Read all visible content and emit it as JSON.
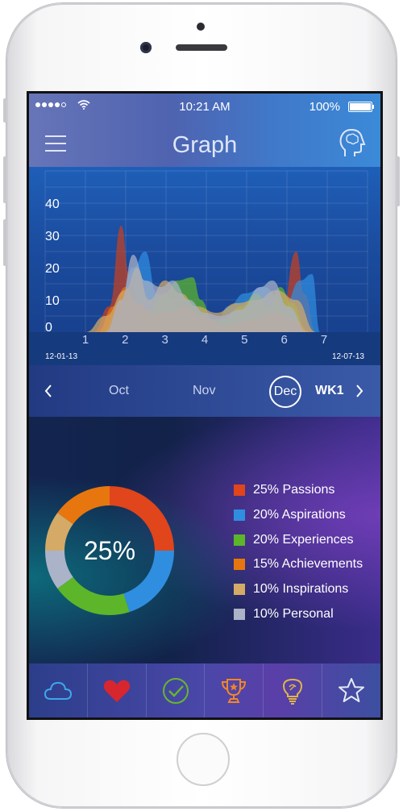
{
  "status": {
    "time": "10:21 AM",
    "battery": "100%"
  },
  "header": {
    "title": "Graph",
    "menu_icon": "hamburger-menu-icon",
    "profile_icon": "head-brain-icon"
  },
  "chart_data": {
    "type": "area",
    "x": [
      1,
      2,
      3,
      4,
      5,
      6,
      7
    ],
    "yticks": [
      0,
      10,
      20,
      30,
      40
    ],
    "ylim": [
      0,
      45
    ],
    "xlim": [
      1,
      7
    ],
    "grid": true,
    "start_date": "12-01-13",
    "end_date": "12-07-13",
    "series": [
      {
        "color": "#c8401e",
        "points": [
          [
            1.2,
            0
          ],
          [
            1.6,
            8
          ],
          [
            1.9,
            33
          ],
          [
            2.1,
            18
          ],
          [
            2.4,
            2
          ],
          [
            2.9,
            0
          ],
          [
            4.4,
            0
          ],
          [
            5.2,
            0
          ],
          [
            5.9,
            3
          ],
          [
            6.3,
            25
          ],
          [
            6.5,
            12
          ],
          [
            6.8,
            0
          ]
        ]
      },
      {
        "color": "#2f8ee0",
        "points": [
          [
            1.4,
            0
          ],
          [
            1.8,
            6
          ],
          [
            2.2,
            20
          ],
          [
            2.5,
            25
          ],
          [
            2.8,
            12
          ],
          [
            3.1,
            10
          ],
          [
            3.5,
            4
          ],
          [
            4.2,
            0
          ],
          [
            4.6,
            8
          ],
          [
            5.0,
            12
          ],
          [
            5.5,
            14
          ],
          [
            6.0,
            8
          ],
          [
            6.4,
            16
          ],
          [
            6.7,
            18
          ],
          [
            6.9,
            0
          ]
        ]
      },
      {
        "color": "#5db52a",
        "points": [
          [
            2.0,
            0
          ],
          [
            2.5,
            6
          ],
          [
            3.0,
            12
          ],
          [
            3.3,
            16
          ],
          [
            3.7,
            17
          ],
          [
            3.9,
            10
          ],
          [
            4.2,
            4
          ],
          [
            4.5,
            4
          ],
          [
            4.9,
            8
          ],
          [
            5.3,
            12
          ],
          [
            5.6,
            8
          ],
          [
            5.9,
            14
          ],
          [
            6.2,
            9
          ],
          [
            6.6,
            0
          ]
        ]
      },
      {
        "color": "#e8760f",
        "points": [
          [
            1.3,
            0
          ],
          [
            1.7,
            8
          ],
          [
            2.0,
            14
          ],
          [
            2.3,
            9
          ],
          [
            2.7,
            6
          ],
          [
            3.1,
            6
          ],
          [
            3.5,
            8
          ],
          [
            3.9,
            5
          ],
          [
            4.5,
            2
          ],
          [
            5.2,
            4
          ],
          [
            5.8,
            6
          ],
          [
            6.2,
            4
          ],
          [
            6.7,
            0
          ]
        ]
      },
      {
        "color": "#d4aa66",
        "points": [
          [
            1.0,
            0
          ],
          [
            1.5,
            5
          ],
          [
            2.0,
            13
          ],
          [
            2.3,
            20
          ],
          [
            2.6,
            10
          ],
          [
            3.0,
            16
          ],
          [
            3.4,
            12
          ],
          [
            3.8,
            8
          ],
          [
            4.3,
            6
          ],
          [
            4.8,
            9
          ],
          [
            5.3,
            10
          ],
          [
            5.8,
            13
          ],
          [
            6.3,
            10
          ],
          [
            6.8,
            0
          ]
        ]
      },
      {
        "color": "#aab3c7",
        "points": [
          [
            1.5,
            0
          ],
          [
            1.9,
            10
          ],
          [
            2.2,
            24
          ],
          [
            2.5,
            16
          ],
          [
            2.9,
            14
          ],
          [
            3.2,
            16
          ],
          [
            3.6,
            10
          ],
          [
            4.0,
            6
          ],
          [
            4.4,
            5
          ],
          [
            4.9,
            7
          ],
          [
            5.4,
            14
          ],
          [
            5.7,
            16
          ],
          [
            6.1,
            8
          ],
          [
            6.6,
            0
          ]
        ]
      }
    ]
  },
  "nav": {
    "prev_icon": "chevron-left-icon",
    "months": [
      "Oct",
      "Nov",
      "Dec"
    ],
    "selected": "Dec",
    "week": "WK1",
    "next_icon": "chevron-right-icon"
  },
  "donut": {
    "center_label": "25%",
    "segments": [
      {
        "label": "25% Passions",
        "value": 25,
        "color": "#e0451b"
      },
      {
        "label": "20% Aspirations",
        "value": 20,
        "color": "#2f8ee0"
      },
      {
        "label": "20% Experiences",
        "value": 20,
        "color": "#5db52a"
      },
      {
        "label": "15% Achievements",
        "value": 15,
        "color": "#e8760f"
      },
      {
        "label": "10% Inspirations",
        "value": 10,
        "color": "#d4aa66"
      },
      {
        "label": "10% Personal",
        "value": 10,
        "color": "#aab3c7"
      }
    ],
    "donut_order": [
      0,
      1,
      2,
      5,
      4,
      3
    ]
  },
  "tabs": [
    {
      "icon": "cloud-icon",
      "color": "#3fa6ea"
    },
    {
      "icon": "heart-icon",
      "color": "#d8262f"
    },
    {
      "icon": "checkmark-icon",
      "color": "#68b72b"
    },
    {
      "icon": "trophy-icon",
      "color": "#f0862a"
    },
    {
      "icon": "lightbulb-icon",
      "color": "#e0b548"
    },
    {
      "icon": "star-icon",
      "color": "#e6ebf5"
    }
  ]
}
